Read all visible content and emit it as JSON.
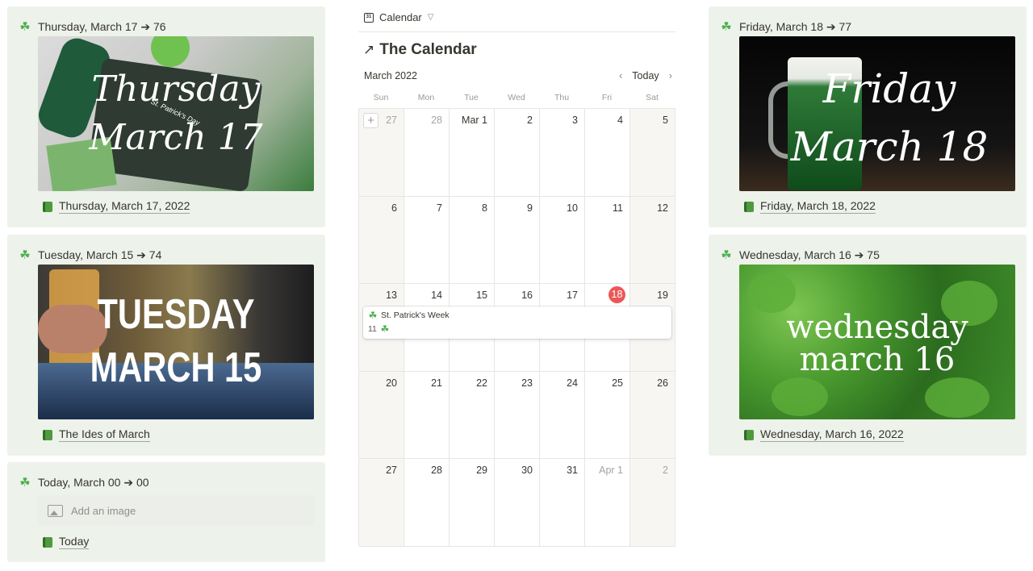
{
  "cards": {
    "thursday": {
      "header": "Thursday, March 17 ➔ 76",
      "image_line1": "Thursday",
      "image_line2": "March 17",
      "image_badge": "St. Patrick's Day",
      "link": "Thursday, March 17, 2022"
    },
    "tuesday": {
      "header": "Tuesday, March 15 ➔ 74",
      "image_line1": "TUESDAY",
      "image_line2": "MARCH 15",
      "link": "The Ides of March"
    },
    "today": {
      "header": "Today, March 00 ➔ 00",
      "add_image": "Add an image",
      "link": "Today"
    },
    "friday": {
      "header": "Friday, March 18 ➔ 77",
      "image_line1": "Friday",
      "image_line2": "March 18",
      "link": "Friday, March 18, 2022"
    },
    "wednesday": {
      "header": "Wednesday, March 16 ➔ 75",
      "image_line1": "wednesday",
      "image_line2": "march 16",
      "link": "Wednesday, March 16, 2022"
    }
  },
  "calendar": {
    "view_tab": "Calendar",
    "title": "The Calendar",
    "month": "March 2022",
    "today_button": "Today",
    "weekdays": [
      "Sun",
      "Mon",
      "Tue",
      "Wed",
      "Thu",
      "Fri",
      "Sat"
    ],
    "weeks": [
      [
        "27",
        "28",
        "Mar 1",
        "2",
        "3",
        "4",
        "5"
      ],
      [
        "6",
        "7",
        "8",
        "9",
        "10",
        "11",
        "12"
      ],
      [
        "13",
        "14",
        "15",
        "16",
        "17",
        "18",
        "19"
      ],
      [
        "20",
        "21",
        "22",
        "23",
        "24",
        "25",
        "26"
      ],
      [
        "27",
        "28",
        "29",
        "30",
        "31",
        "Apr 1",
        "2"
      ]
    ],
    "today_date": "18",
    "event": {
      "title": "St. Patrick's Week",
      "detail": "11"
    }
  },
  "colors": {
    "card_bg": "#edf2ea",
    "today_marker": "#eb5757",
    "shamrock": "#4caf50"
  },
  "icons": {
    "card_header": "shamrock-icon",
    "card_link": "book-icon",
    "calendar_tab": "calendar-icon",
    "title": "arrow-up-right-icon"
  }
}
